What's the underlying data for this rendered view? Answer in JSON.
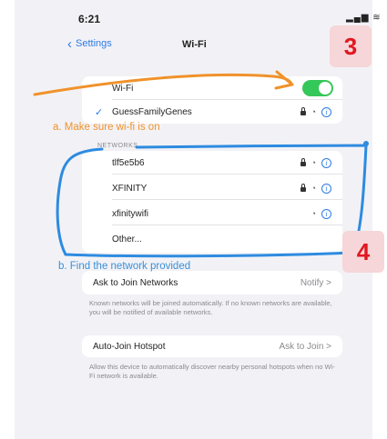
{
  "status_bar": {
    "time": "6:21",
    "signal_icons": "••▎ ☰"
  },
  "nav": {
    "back_label": "Settings",
    "title": "Wi-Fi"
  },
  "wifi_group": {
    "toggle_label": "Wi-Fi",
    "toggle_on": true,
    "connected_network": "GuessFamilyGenes"
  },
  "networks_header": "NETWORKS",
  "networks": [
    {
      "name": "tlf5e5b6",
      "secured": true
    },
    {
      "name": "XFINITY",
      "secured": true
    },
    {
      "name": "xfinitywifi",
      "secured": false
    }
  ],
  "other_label": "Other...",
  "ask_to_join": {
    "label": "Ask to Join Networks",
    "value": "Notify >",
    "footnote": "Known networks will be joined automatically. If no known networks are available, you will be notified of available networks."
  },
  "auto_join": {
    "label": "Auto-Join Hotspot",
    "value": "Ask to Join >",
    "footnote": "Allow this device to automatically discover nearby personal hotspots when no Wi-Fi network is available."
  },
  "annotations": {
    "step_a": "a. Make sure wi-fi is on",
    "step_b": "b. Find the network provided",
    "badge_3": "3",
    "badge_4": "4",
    "colors": {
      "orange": "#f0922b",
      "blue": "#3a8fd8",
      "badge_red": "#e0181f"
    }
  }
}
